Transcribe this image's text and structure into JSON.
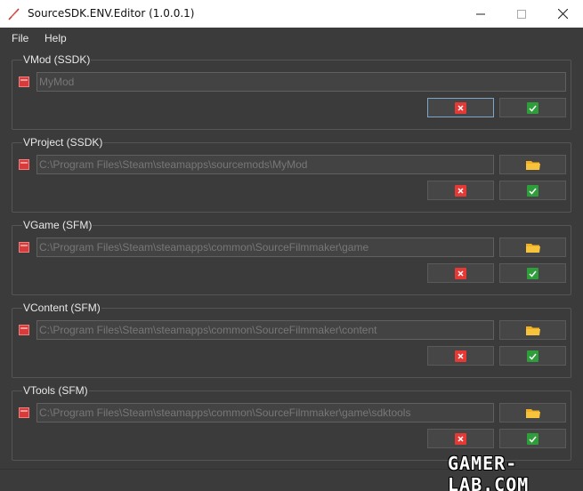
{
  "window": {
    "title": "SourceSDK.ENV.Editor (1.0.0.1)"
  },
  "menu": {
    "items": [
      "File",
      "Help"
    ]
  },
  "groups": [
    {
      "title": "VMod (SSDK)",
      "value": "MyMod",
      "has_browse": false
    },
    {
      "title": "VProject (SSDK)",
      "value": "C:\\Program Files\\Steam\\steamapps\\sourcemods\\MyMod",
      "has_browse": true
    },
    {
      "title": "VGame (SFM)",
      "value": "C:\\Program Files\\Steam\\steamapps\\common\\SourceFilmmaker\\game",
      "has_browse": true
    },
    {
      "title": "VContent (SFM)",
      "value": "C:\\Program Files\\Steam\\steamapps\\common\\SourceFilmmaker\\content",
      "has_browse": true
    },
    {
      "title": "VTools (SFM)",
      "value": "C:\\Program Files\\Steam\\steamapps\\common\\SourceFilmmaker\\game\\sdktools",
      "has_browse": true
    }
  ],
  "watermark": "GAMER-LAB.COM",
  "colors": {
    "background": "#3b3b3b",
    "cancel_red": "#e53935",
    "confirm_green": "#2e9e3a",
    "folder_yellow": "#f2b01e",
    "focus_border": "#7ea6c8"
  },
  "icons": {
    "app": "feather-icon",
    "flag": "red-flag-icon",
    "cancel": "x-icon",
    "confirm": "check-icon",
    "browse": "folder-icon"
  }
}
